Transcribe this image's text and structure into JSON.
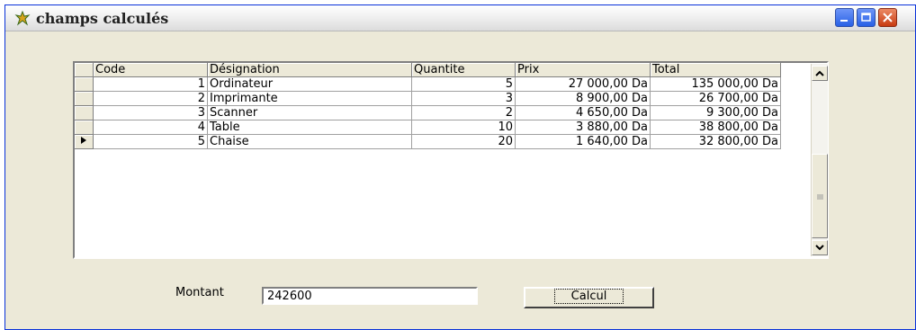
{
  "window": {
    "title": "champs calculés"
  },
  "grid": {
    "columns": [
      "Code",
      "Désignation",
      "Quantite",
      "Prix",
      "Total"
    ],
    "rows": [
      {
        "code": "1",
        "designation": "Ordinateur",
        "quantite": "5",
        "prix": "27 000,00 Da",
        "total": "135 000,00 Da",
        "current": false
      },
      {
        "code": "2",
        "designation": "Imprimante",
        "quantite": "3",
        "prix": "8 900,00 Da",
        "total": "26 700,00 Da",
        "current": false
      },
      {
        "code": "3",
        "designation": "Scanner",
        "quantite": "2",
        "prix": "4 650,00 Da",
        "total": "9 300,00 Da",
        "current": false
      },
      {
        "code": "4",
        "designation": "Table",
        "quantite": "10",
        "prix": "3 880,00 Da",
        "total": "38 800,00 Da",
        "current": false
      },
      {
        "code": "5",
        "designation": "Chaise",
        "quantite": "20",
        "prix": "1 640,00 Da",
        "total": "32 800,00 Da",
        "current": true
      }
    ]
  },
  "form": {
    "amount_label": "Montant",
    "amount_value": "242600",
    "calc_button": "Calcul"
  }
}
